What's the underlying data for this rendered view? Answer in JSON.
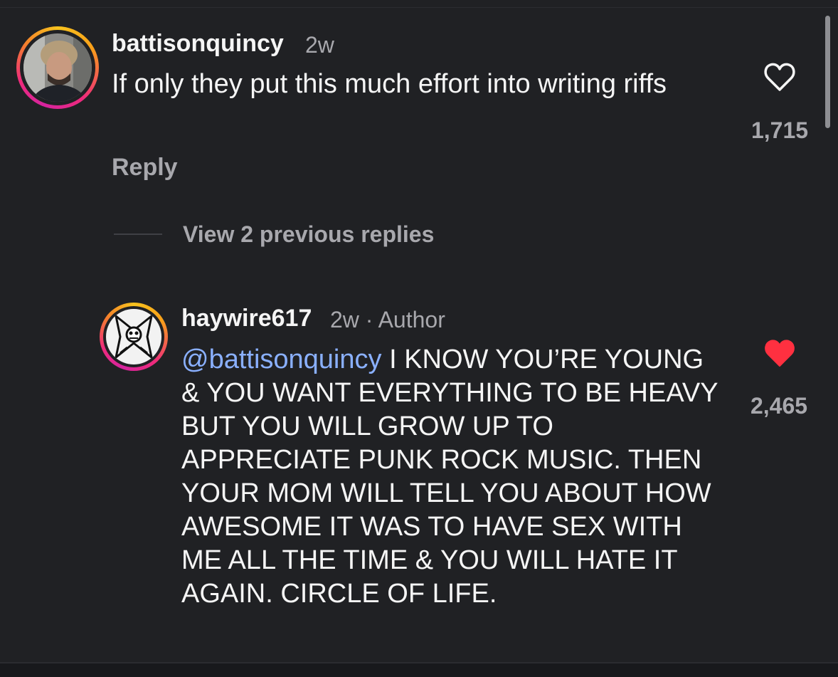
{
  "colors": {
    "background": "#202124",
    "mention": "#8ab0ff",
    "liked_heart": "#ff3040",
    "secondary_text": "#a8a8ad"
  },
  "comments": [
    {
      "username": "battisonquincy",
      "time": "2w",
      "text": "If only they put this much effort into writing riffs",
      "reply_label": "Reply",
      "like_count": "1,715",
      "liked": false,
      "like_icon": "heart-outline-icon"
    }
  ],
  "view_replies_label": "View 2 previous replies",
  "reply": {
    "username": "haywire617",
    "time": "2w",
    "separator": "·",
    "author_badge": "Author",
    "mention": "@battisonquincy",
    "text": "I KNOW YOU’RE YOUNG & YOU WANT EVERYTHING TO BE HEAVY BUT YOU WILL GROW UP TO APPRECIATE PUNK ROCK MUSIC. THEN YOUR MOM WILL TELL YOU ABOUT HOW AWESOME IT WAS TO HAVE SEX WITH ME ALL THE TIME & YOU WILL HATE IT AGAIN. CIRCLE OF LIFE.",
    "like_count": "2,465",
    "liked": true,
    "like_icon": "heart-filled-icon"
  }
}
